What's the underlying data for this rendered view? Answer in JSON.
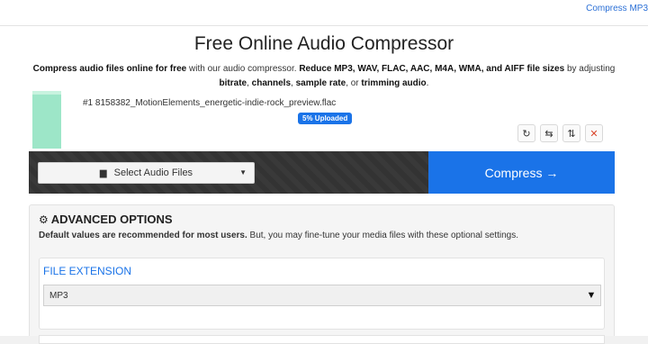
{
  "top_nav": {
    "link_text": "Compress MP3"
  },
  "page": {
    "title": "Free Online Audio Compressor",
    "desc_b1": "Compress audio files online for free",
    "desc_t1": " with our audio compressor. ",
    "desc_b2": "Reduce MP3, WAV, FLAC, AAC, M4A, WMA, and AIFF file sizes",
    "desc_t2": " by adjusting ",
    "desc_b3": "bitrate",
    "desc_t3": ", ",
    "desc_b4": "channels",
    "desc_t4": ", ",
    "desc_b5": "sample rate",
    "desc_t5": ", or ",
    "desc_b6": "trimming audio",
    "desc_t6": "."
  },
  "file": {
    "name": "#1 8158382_MotionElements_energetic-indie-rock_preview.flac",
    "upload_status": "5% Uploaded",
    "upload_progress_percent": 5,
    "thumb_color": "#9de6c8"
  },
  "file_tools": [
    {
      "name": "rotate-icon",
      "glyph": "↻"
    },
    {
      "name": "swap-icon",
      "glyph": "⇆"
    },
    {
      "name": "sort-icon",
      "glyph": "⇅"
    },
    {
      "name": "close-icon",
      "glyph": "✕"
    }
  ],
  "actions": {
    "select_label": "Select Audio Files",
    "compress_label": "Compress →",
    "accent_color": "#1a73e8"
  },
  "advanced": {
    "title": "ADVANCED OPTIONS",
    "note_bold": "Default values are recommended for most users.",
    "note_rest": " But, you may fine-tune your media files with these optional settings.",
    "extension_label": "FILE EXTENSION",
    "extension_value": "MP3"
  }
}
